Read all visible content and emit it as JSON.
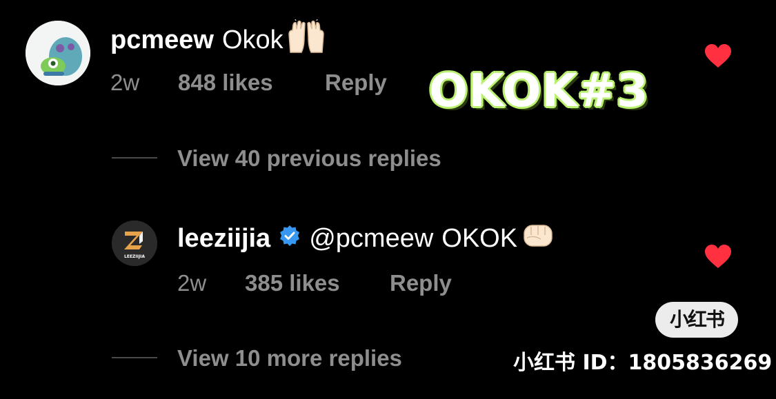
{
  "overlay": {
    "title": "OKOK#3"
  },
  "comments": [
    {
      "username": "pcmeew",
      "text": "Okok",
      "emoji": "raising-hands-icon",
      "time": "2w",
      "likes": "848 likes",
      "reply": "Reply",
      "liked": true
    },
    {
      "username": "leeziijia",
      "verified": true,
      "mention": "@pcmeew",
      "text": "OKOK",
      "emoji": "fist-icon",
      "time": "2w",
      "likes": "385 likes",
      "reply": "Reply",
      "liked": true,
      "avatar_text": "LEEZIIJIA"
    }
  ],
  "view_replies": [
    {
      "label": "View 40 previous replies"
    },
    {
      "label": "View 10 more replies"
    }
  ],
  "watermark": {
    "badge": "小红书",
    "id_line": "小红书 ID：1805836269"
  },
  "colors": {
    "background": "#000000",
    "muted_text": "#8e8e8e",
    "heart": "#ff3040",
    "verified": "#3897f0",
    "overlay_outline": "#b9f06f"
  }
}
